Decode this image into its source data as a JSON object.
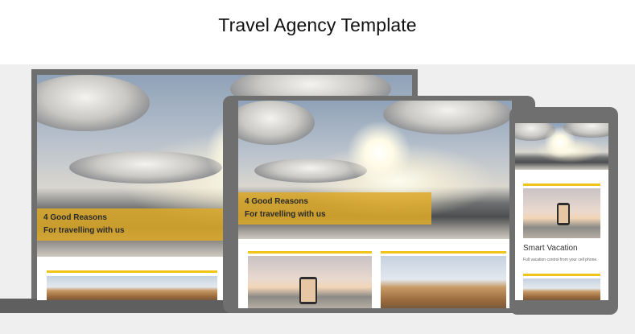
{
  "title": "Travel Agency Template",
  "banner": {
    "line1": "4 Good Reasons",
    "line2": "For travelling with us"
  },
  "mobile": {
    "card_title": "Smart Vacation",
    "card_body": "Full vacation control from your cell phone."
  },
  "colors": {
    "accent": "#f0c419",
    "banner": "#deaa28",
    "device_frame": "#6f6f6f",
    "stage_background": "#efefef"
  }
}
